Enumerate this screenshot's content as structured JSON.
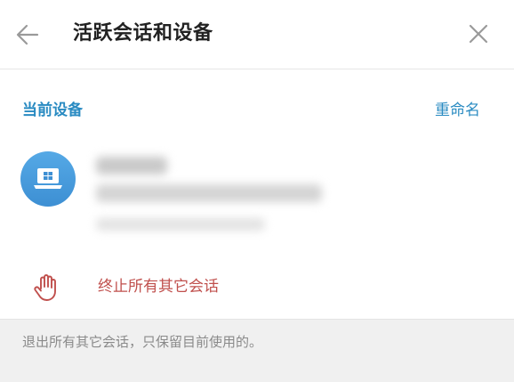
{
  "header": {
    "title": "活跃会话和设备",
    "back_icon": "arrow-left-icon",
    "close_icon": "close-icon"
  },
  "current_device": {
    "section_title": "当前设备",
    "rename_label": "重命名",
    "device_icon": "laptop-icon",
    "accent_color": "#2a8bc2"
  },
  "actions": {
    "terminate_label": "终止所有其它会话",
    "terminate_icon": "hand-stop-icon",
    "terminate_color": "#c0504d"
  },
  "footer": {
    "hint": "退出所有其它会话，只保留目前使用的。"
  }
}
